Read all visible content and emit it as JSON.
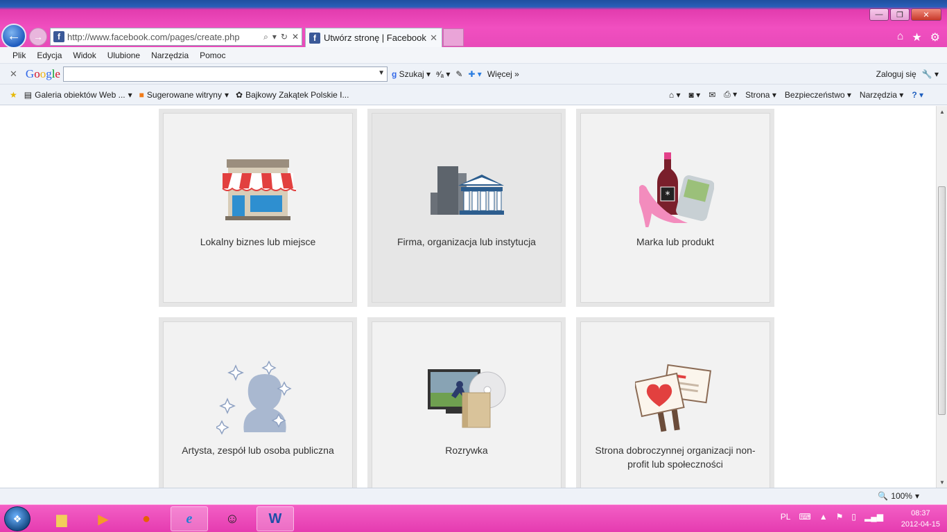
{
  "window": {
    "address_url": "http://www.facebook.com/pages/create.php",
    "tab_title": "Utwórz stronę | Facebook"
  },
  "menu": [
    "Plik",
    "Edycja",
    "Widok",
    "Ulubione",
    "Narzędzia",
    "Pomoc"
  ],
  "google_toolbar": {
    "logo": "Google",
    "search_value": "",
    "search_label": "Szukaj",
    "more_label": "Więcej",
    "login_label": "Zaloguj się"
  },
  "favorites": {
    "items": [
      "Galeria obiektów Web ...",
      "Sugerowane witryny",
      "Bajkowy Zakątek Polskie I..."
    ],
    "right_items": [
      "Strona",
      "Bezpieczeństwo",
      "Narzędzia"
    ]
  },
  "cards": [
    {
      "label": "Lokalny biznes lub miejsce",
      "icon": "storefront-icon"
    },
    {
      "label": "Firma, organizacja lub instytucja",
      "icon": "buildings-icon"
    },
    {
      "label": "Marka lub produkt",
      "icon": "products-icon"
    },
    {
      "label": "Artysta, zespół lub osoba publiczna",
      "icon": "artist-silhouette-icon"
    },
    {
      "label": "Rozrywka",
      "icon": "entertainment-icon"
    },
    {
      "label": "Strona dobroczynnej organizacji non-profit lub społeczności",
      "icon": "charity-signs-icon"
    }
  ],
  "status": {
    "zoom": "100%"
  },
  "taskbar": {
    "lang": "PL",
    "time": "08:37",
    "date": "2012-04-15"
  },
  "colors": {
    "accent_pink": "#e84ab9",
    "facebook_blue": "#3b5998",
    "card_bg": "#f2f2f2"
  }
}
